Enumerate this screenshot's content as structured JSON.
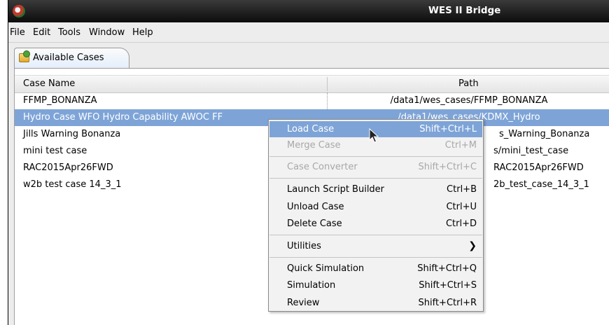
{
  "window": {
    "title": "WES II Bridge"
  },
  "menubar": [
    "File",
    "Edit",
    "Tools",
    "Window",
    "Help"
  ],
  "tab": {
    "label": "Available Cases"
  },
  "table": {
    "columns": [
      "Case Name",
      "Path"
    ],
    "rows": [
      {
        "name": "FFMP_BONANZA",
        "path": "/data1/wes_cases/FFMP_BONANZA"
      },
      {
        "name": "Hydro Case WFO Hydro Capability AWOC FF",
        "path": "/data1/wes_cases/KDMX_Hydro"
      },
      {
        "name": "Jills Warning Bonanza",
        "path": "s_Warning_Bonanza"
      },
      {
        "name": "mini test case",
        "path": "s/mini_test_case"
      },
      {
        "name": "RAC2015Apr26FWD",
        "path": "RAC2015Apr26FWD"
      },
      {
        "name": "w2b test case 14_3_1",
        "path": "2b_test_case_14_3_1"
      }
    ],
    "selected_index": 1
  },
  "context_menu": {
    "items": [
      {
        "label": "Load Case",
        "accel": "Shift+Ctrl+L"
      },
      {
        "label": "Merge Case",
        "accel": "Ctrl+M"
      },
      {
        "label": "Case Converter",
        "accel": "Shift+Ctrl+C"
      },
      {
        "label": "Launch Script Builder",
        "accel": "Ctrl+B"
      },
      {
        "label": "Unload Case",
        "accel": "Ctrl+U"
      },
      {
        "label": "Delete Case",
        "accel": "Ctrl+D"
      },
      {
        "label": "Utilities",
        "accel": ""
      },
      {
        "label": "Quick Simulation",
        "accel": "Shift+Ctrl+Q"
      },
      {
        "label": "Simulation",
        "accel": "Shift+Ctrl+S"
      },
      {
        "label": "Review",
        "accel": "Shift+Ctrl+R"
      }
    ],
    "highlighted": "Load Case",
    "disabled": [
      "Merge Case",
      "Case Converter"
    ],
    "submenu_icon": "chevron-right-icon"
  },
  "colors": {
    "selection": "#7ea4d7",
    "titlebar": "#1a1a1a"
  }
}
